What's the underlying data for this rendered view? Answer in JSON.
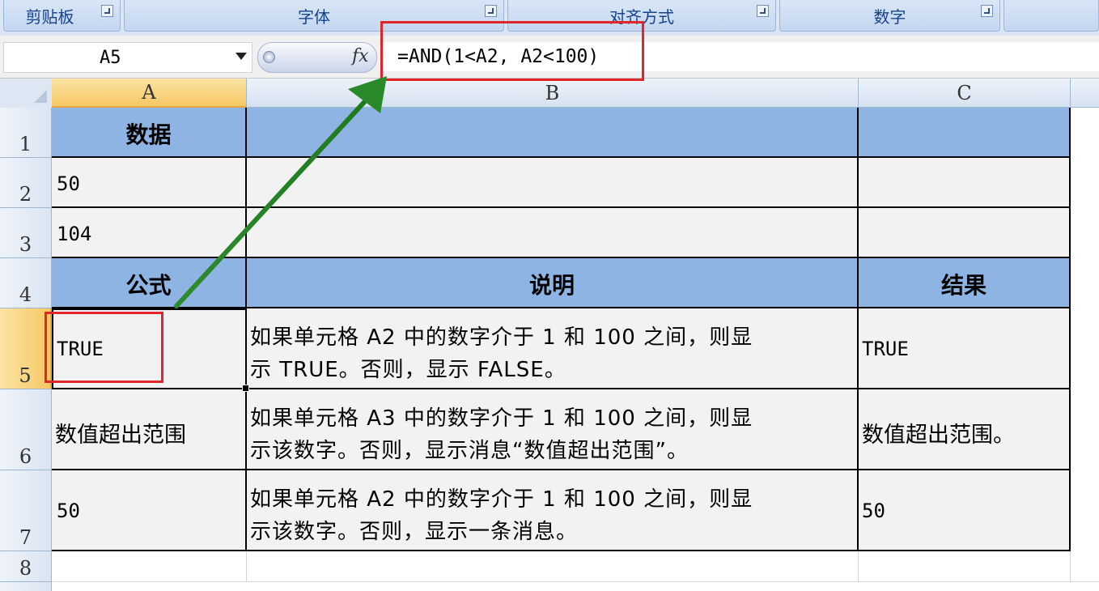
{
  "ribbon": {
    "groups": [
      {
        "label": "剪贴板"
      },
      {
        "label": "字体"
      },
      {
        "label": "对齐方式"
      },
      {
        "label": "数字"
      }
    ]
  },
  "formula_bar": {
    "name_box": "A5",
    "fx_label": "fx",
    "formula": "=AND(1<A2, A2<100)"
  },
  "columns": [
    "A",
    "B",
    "C"
  ],
  "rows": [
    "1",
    "2",
    "3",
    "4",
    "5",
    "6",
    "7",
    "8"
  ],
  "cells": {
    "A1": "数据",
    "A2": "50",
    "A3": "104",
    "A4": "公式",
    "B4": "说明",
    "C4": "结果",
    "A5": "TRUE",
    "B5": "如果单元格 A2 中的数字介于 1 和 100 之间，则显\n示 TRUE。否则，显示 FALSE。",
    "C5": "TRUE",
    "A6": "数值超出范围",
    "B6": "如果单元格 A3 中的数字介于 1 和 100 之间，则显\n示该数字。否则，显示消息“数值超出范围”。",
    "C6": "数值超出范围。",
    "A7": "50",
    "B7": "如果单元格 A2 中的数字介于 1 和 100 之间，则显\n示该数字。否则，显示一条消息。",
    "C7": "50"
  },
  "colors": {
    "header_fill": "#8eb4e3",
    "body_fill": "#f2f2f2",
    "highlight_box": "#e0262a",
    "arrow": "#2e8b2e",
    "selected_header": "#f7c865"
  }
}
